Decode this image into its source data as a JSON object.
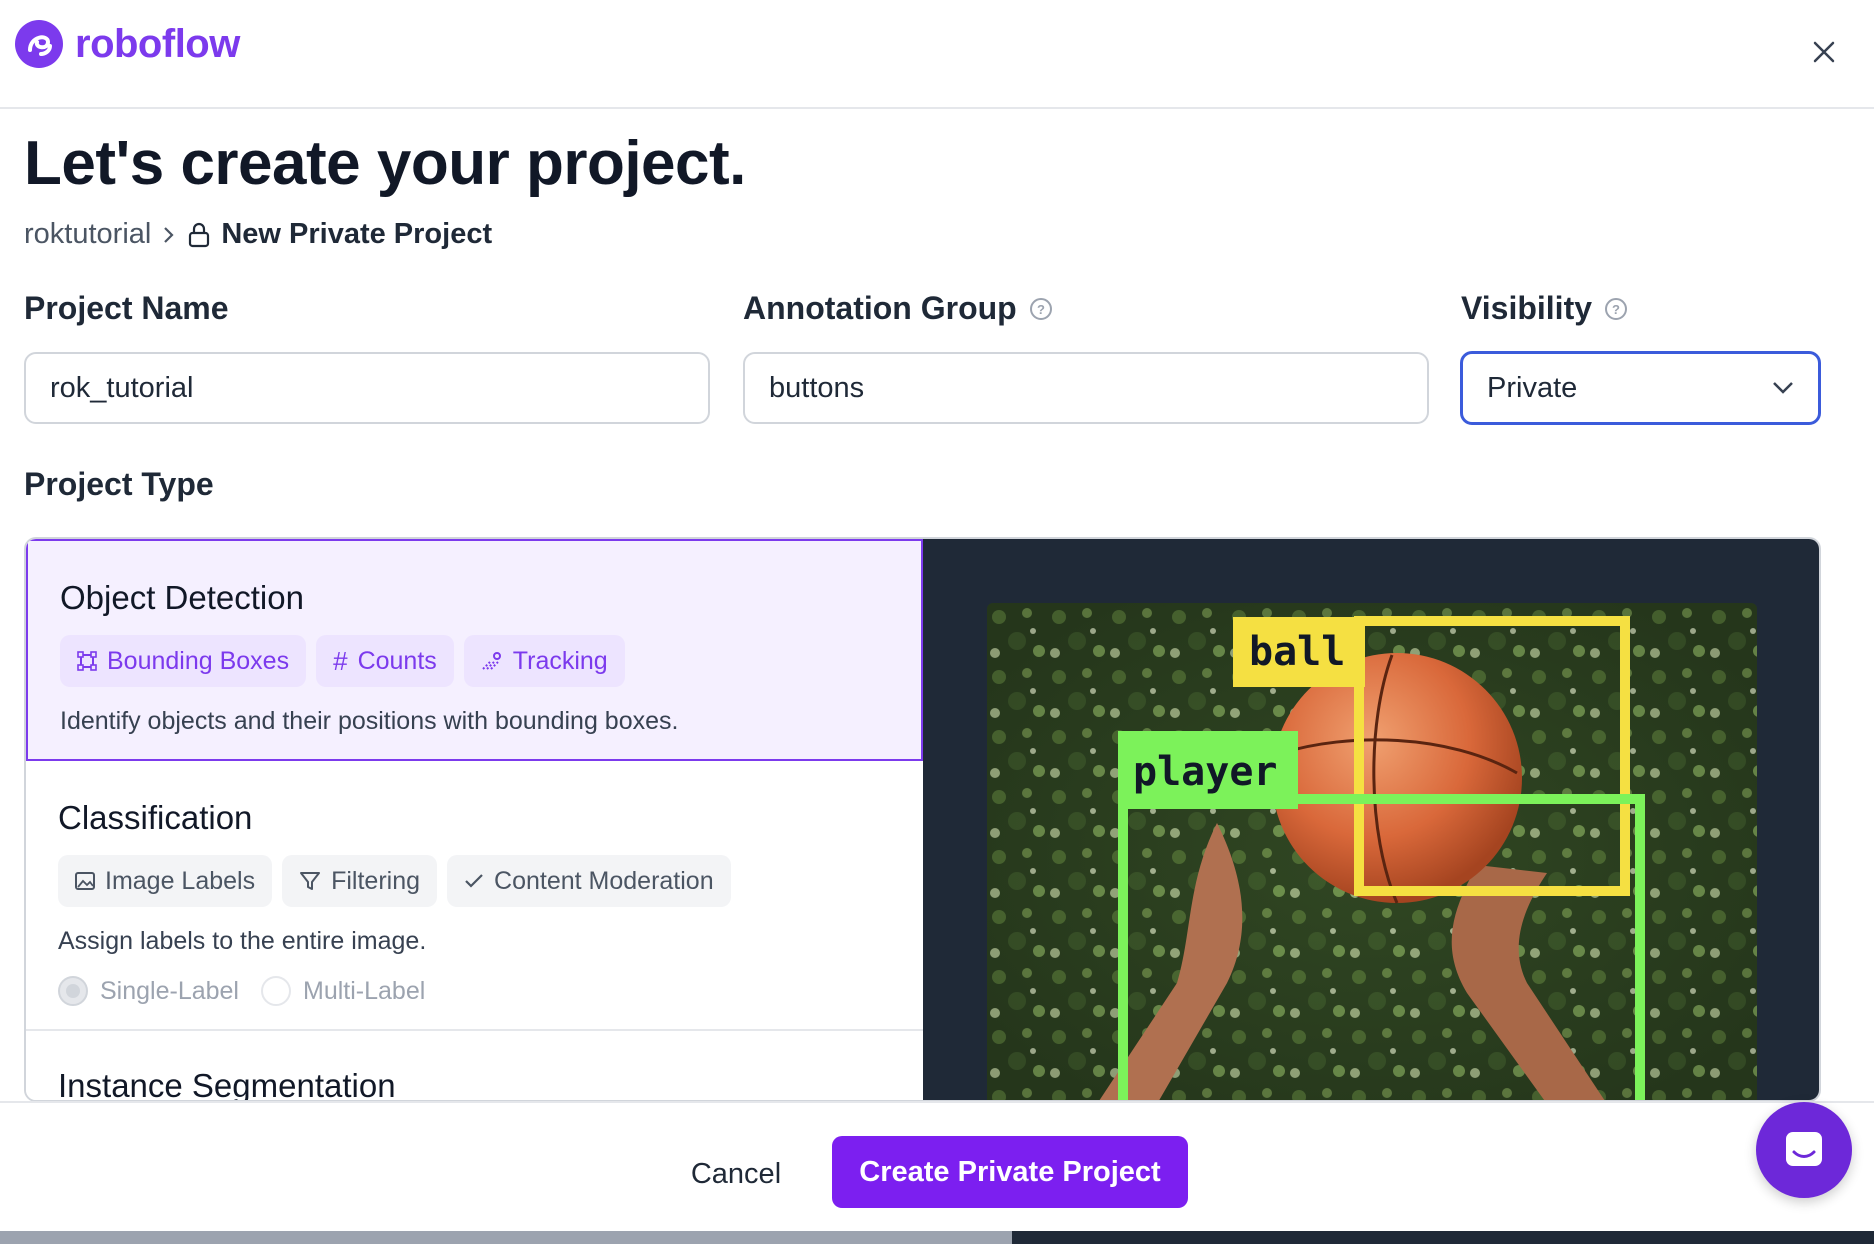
{
  "brand": {
    "name": "roboflow",
    "color": "#7c3aed"
  },
  "header": {
    "close_icon": "close-icon"
  },
  "title": "Let's create your project.",
  "breadcrumb": {
    "workspace": "roktutorial",
    "separator": ">",
    "current": "New Private Project"
  },
  "fields": {
    "project_name": {
      "label": "Project Name",
      "value": "rok_tutorial"
    },
    "annotation_group": {
      "label": "Annotation Group",
      "value": "buttons"
    },
    "visibility": {
      "label": "Visibility",
      "value": "Private"
    }
  },
  "project_type": {
    "label": "Project Type",
    "selected": "Object Detection",
    "cards": [
      {
        "title": "Object Detection",
        "chips": [
          "Bounding Boxes",
          "Counts",
          "Tracking"
        ],
        "description": "Identify objects and their positions with bounding boxes."
      },
      {
        "title": "Classification",
        "chips": [
          "Image Labels",
          "Filtering",
          "Content Moderation"
        ],
        "description": "Assign labels to the entire image.",
        "radios": [
          "Single-Label",
          "Multi-Label"
        ]
      },
      {
        "title": "Instance Segmentation"
      }
    ],
    "preview": {
      "labels": [
        "ball",
        "player"
      ],
      "box_colors": {
        "ball": "#f5e042",
        "player": "#7cf25a"
      }
    }
  },
  "footer": {
    "cancel_label": "Cancel",
    "create_label": "Create Private Project",
    "accent": "#7c1ff0"
  }
}
